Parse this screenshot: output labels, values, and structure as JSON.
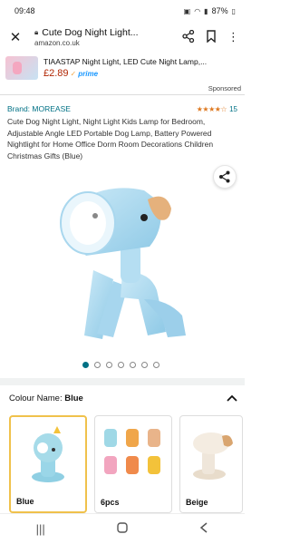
{
  "status_bar": {
    "time": "09:48",
    "battery": "87%"
  },
  "browser": {
    "page_title": "Cute Dog Night Light...",
    "domain": "amazon.co.uk"
  },
  "ad": {
    "title": "TIAASTAP Night Light, LED Cute Night Lamp,...",
    "price": "£2.89",
    "prime_label": "prime",
    "sponsored_label": "Sponsored"
  },
  "product": {
    "brand": "Brand: MOREASE",
    "stars": "★★★★☆",
    "rating_count": "15",
    "title": "Cute Dog Night Light, Night Light Kids Lamp for Bedroom, Adjustable Angle LED Portable Dog Lamp, Battery Powered Nightlight for Home Office Dorm Room Decorations Children Christmas Gifts (Blue)",
    "image_count": 7,
    "active_image": 1
  },
  "colour": {
    "label": "Colour Name:",
    "selected": "Blue",
    "options": [
      {
        "name": "Blue"
      },
      {
        "name": "6pcs"
      },
      {
        "name": "Beige"
      }
    ]
  },
  "colors": {
    "accent": "#007185",
    "price": "#b12704",
    "prime": "#1a98ff",
    "selected_border": "#f0c14b"
  },
  "icons": [
    "close-icon",
    "lock-icon",
    "share-icon",
    "bookmark-icon",
    "more-icon",
    "chevron-up-icon",
    "recents-icon",
    "home-icon",
    "back-icon"
  ]
}
